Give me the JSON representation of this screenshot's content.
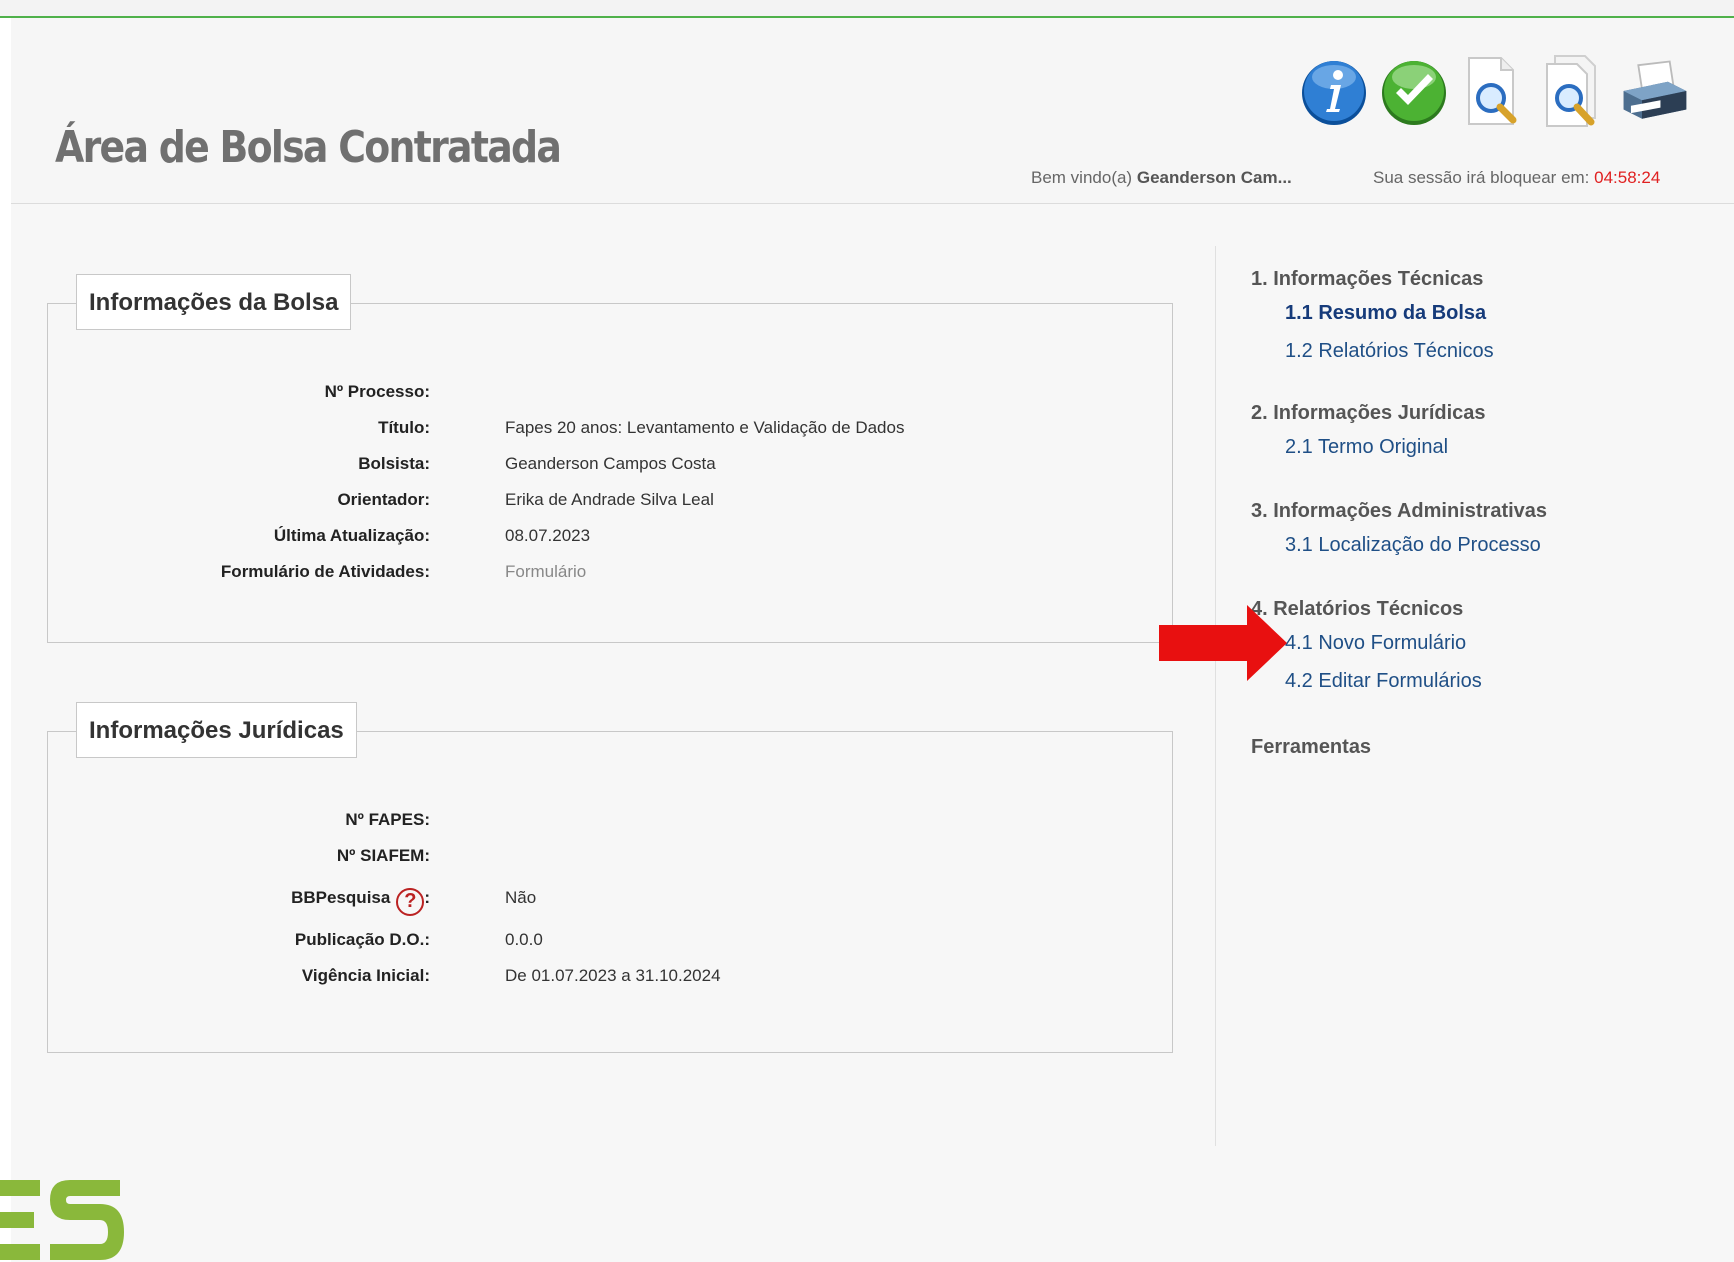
{
  "header": {
    "title": "Área de Bolsa Contratada",
    "welcome_prefix": "Bem vindo(a)",
    "user_name": "Geanderson Cam...",
    "session_label": "Sua sessão irá bloquear em:",
    "session_timer": "04:58:24",
    "toolbar_icons": [
      "info-icon",
      "check-icon",
      "zoom-document-icon",
      "zoom-documents-icon",
      "printer-icon"
    ]
  },
  "bolsa": {
    "legend": "Informações da Bolsa",
    "rows": [
      {
        "label": "Nº Processo:",
        "value": ""
      },
      {
        "label": "Título:",
        "value": "Fapes 20 anos: Levantamento e Validação de Dados"
      },
      {
        "label": "Bolsista:",
        "value": "Geanderson Campos Costa"
      },
      {
        "label": "Orientador:",
        "value": "Erika de Andrade Silva Leal"
      },
      {
        "label": "Última Atualização:",
        "value": "08.07.2023"
      },
      {
        "label": "Formulário de Atividades:",
        "value": "Formulário"
      }
    ]
  },
  "juridicas": {
    "legend": "Informações Jurídicas",
    "rows": [
      {
        "label": "Nº FAPES:",
        "value": ""
      },
      {
        "label": "Nº SIAFEM:",
        "value": ""
      },
      {
        "label": "BBPesquisa",
        "label_suffix": ":",
        "value": "Não"
      },
      {
        "label": "Publicação D.O.:",
        "value": "0.0.0"
      },
      {
        "label": "Vigência Inicial:",
        "value": "De 01.07.2023 a 31.10.2024"
      }
    ]
  },
  "menu": {
    "groups": [
      {
        "title": "1. Informações Técnicas",
        "items": [
          "1.1 Resumo da Bolsa",
          "1.2 Relatórios Técnicos"
        ]
      },
      {
        "title": "2. Informações Jurídicas",
        "items": [
          "2.1 Termo Original"
        ]
      },
      {
        "title": "3. Informações Administrativas",
        "items": [
          "3.1 Localização do Processo"
        ]
      },
      {
        "title": "4. Relatórios Técnicos",
        "items": [
          "4.1 Novo Formulário",
          "4.2 Editar Formulários"
        ]
      },
      {
        "title": "Ferramentas",
        "items": []
      }
    ]
  },
  "colors": {
    "accent_green": "#4fb14a",
    "link_blue": "#1f4f86",
    "timer_red": "#e02020",
    "arrow_red": "#e81010"
  }
}
